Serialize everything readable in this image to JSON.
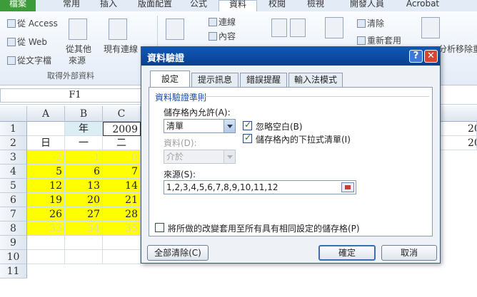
{
  "ribbon_tabs": [
    "檔案",
    "常用",
    "插入",
    "版面配置",
    "公式",
    "資料",
    "校閱",
    "檢視",
    "開發人員",
    "Acrobat"
  ],
  "ribbon": {
    "from_access": "從 Access",
    "from_web": "從 Web",
    "from_text": "從文字檔",
    "from_other": "從其他",
    "from_other_2": "來源",
    "existing_connections": "現有連線",
    "connections": "連線",
    "properties": "內容",
    "clear": "清除",
    "reapply": "重新套用",
    "group_external": "取得外部資料",
    "analyze": "分析",
    "remove_dup": "移除重"
  },
  "name_box": "F1",
  "columns": [
    "A",
    "B",
    "C"
  ],
  "rows": [
    "1",
    "2",
    "3",
    "4",
    "5",
    "6",
    "7",
    "8",
    "9",
    "10",
    "11"
  ],
  "cells": {
    "r1": {
      "A": "",
      "B": "年",
      "C": "2009"
    },
    "r2": {
      "A": "日",
      "B": "一",
      "C": "二"
    },
    "r3": {
      "A": "-2",
      "B": "-1",
      "C": "0"
    },
    "r4": {
      "A": "5",
      "B": "6",
      "C": "7"
    },
    "r5": {
      "A": "12",
      "B": "13",
      "C": "14"
    },
    "r6": {
      "A": "19",
      "B": "20",
      "C": "21"
    },
    "r7": {
      "A": "26",
      "B": "27",
      "C": "28"
    },
    "r8": {
      "A": "33",
      "B": "34",
      "C": "35"
    }
  },
  "right_edge_values": [
    "20",
    "20"
  ],
  "dialog": {
    "title": "資料驗證",
    "tabs": [
      "設定",
      "提示訊息",
      "錯誤提醒",
      "輸入法模式"
    ],
    "active_tab": "設定",
    "group_label": "資料驗證準則",
    "allow_label": "儲存格內允許(A):",
    "allow_value": "清單",
    "ignore_blank": "忽略空白(B)",
    "in_cell_dropdown": "儲存格內的下拉式清單(I)",
    "data_label": "資料(D):",
    "data_value": "介於",
    "source_label": "來源(S):",
    "source_value": "1,2,3,4,5,6,7,8,9,10,11,12",
    "apply_all": "將所做的改變套用至所有具有相同設定的儲存格(P)",
    "clear_all": "全部清除(C)",
    "ok": "確定",
    "cancel": "取消",
    "help": "?",
    "close": "✕",
    "check_mark": "✓"
  }
}
